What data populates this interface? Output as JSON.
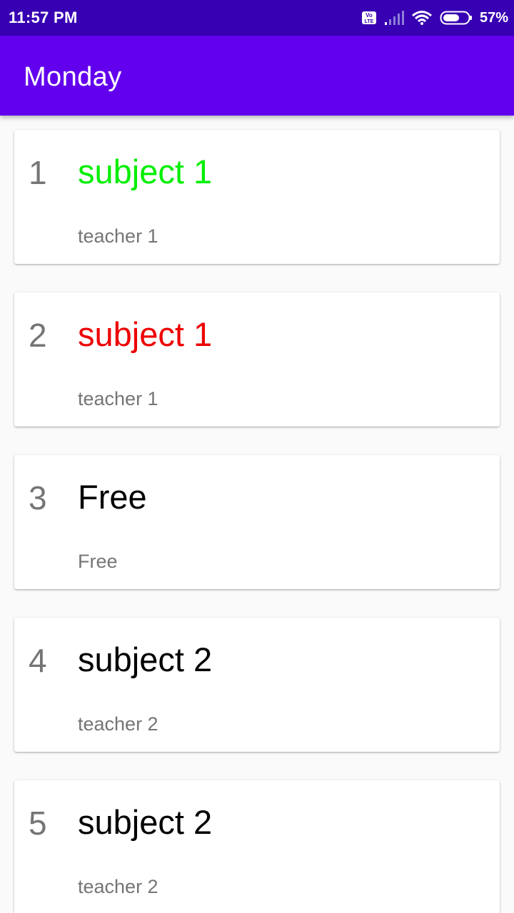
{
  "status_bar": {
    "time": "11:57 PM",
    "battery": "57%",
    "icons": [
      "volte-icon",
      "signal-icon",
      "wifi-icon",
      "battery-icon"
    ]
  },
  "app_bar": {
    "title": "Monday"
  },
  "periods": [
    {
      "number": "1",
      "subject": "subject 1",
      "teacher": "teacher 1",
      "subject_color": "#00ee00"
    },
    {
      "number": "2",
      "subject": "subject 1",
      "teacher": "teacher 1",
      "subject_color": "#ee0000"
    },
    {
      "number": "3",
      "subject": "Free",
      "teacher": "Free",
      "subject_color": "#000000"
    },
    {
      "number": "4",
      "subject": "subject 2",
      "teacher": "teacher 2",
      "subject_color": "#000000"
    },
    {
      "number": "5",
      "subject": "subject 2",
      "teacher": "teacher 2",
      "subject_color": "#000000"
    }
  ],
  "colors": {
    "status_bar": "#3700b3",
    "app_bar": "#6200ee",
    "background": "#fafafa",
    "secondary_text": "#757575"
  }
}
